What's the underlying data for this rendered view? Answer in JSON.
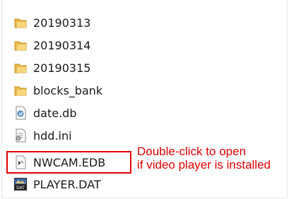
{
  "files": [
    {
      "name": "20190313",
      "icon": "folder-icon"
    },
    {
      "name": "20190314",
      "icon": "folder-icon"
    },
    {
      "name": "20190315",
      "icon": "folder-icon"
    },
    {
      "name": "blocks_bank",
      "icon": "folder-icon"
    },
    {
      "name": "date.db",
      "icon": "db-file-icon"
    },
    {
      "name": "hdd.ini",
      "icon": "ini-file-icon"
    },
    {
      "name": "NWCAM.EDB",
      "icon": "edb-file-icon"
    },
    {
      "name": "PLAYER.DAT",
      "icon": "dat-file-icon"
    }
  ],
  "annotation": {
    "line1": "Double-click to open",
    "line2": "if video player is installed"
  },
  "colors": {
    "annotation": "#e00000",
    "folder": "#e9b949"
  }
}
